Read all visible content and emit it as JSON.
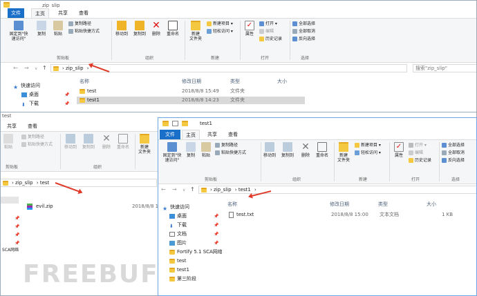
{
  "ribbon": {
    "tabs": [
      "文件",
      "主页",
      "共享",
      "查看"
    ],
    "pin_quick": "固定到\"快\n速访问\"",
    "copy": "复制",
    "paste": "粘贴",
    "copy_path": "复制路径",
    "paste_shortcut": "粘贴快捷方式",
    "cut": "",
    "move_to": "移动到",
    "copy_to": "复制到",
    "delete": "删除",
    "rename": "重命名",
    "new_folder": "新建\n文件夹",
    "new_item": "新建项目",
    "easy_access": "轻松访问",
    "properties": "属性",
    "open": "打开",
    "edit": "编辑",
    "history": "历史记录",
    "select_all": "全部选择",
    "select_none": "全部取消",
    "invert": "反向选择",
    "groups": {
      "clipboard": "剪贴板",
      "organize": "组织",
      "new": "新建",
      "open": "打开",
      "select": "选择"
    }
  },
  "win1": {
    "title": "zip_slip",
    "path": [
      "zip_slip"
    ],
    "search_placeholder": "搜索\"zip_slip\"",
    "columns": {
      "name": "名称",
      "date": "修改日期",
      "type": "类型",
      "size": "大小"
    },
    "quick_access": "快速访问",
    "nav": [
      {
        "label": "桌面"
      },
      {
        "label": "下载"
      }
    ],
    "rows": [
      {
        "name": "test",
        "date": "2018/8/8 15:49",
        "type": "文件夹",
        "size": ""
      },
      {
        "name": "test1",
        "date": "2018/8/8 14:23",
        "type": "文件夹",
        "size": ""
      }
    ]
  },
  "win2": {
    "title": "test",
    "path": [
      "zip_slip",
      "test"
    ],
    "sca_label": "SCA网络",
    "rows": [
      {
        "name": "evil.zip",
        "date": "2018/8/8 1..."
      }
    ]
  },
  "win3": {
    "title": "test1",
    "path": [
      "zip_slip",
      "test1"
    ],
    "columns": {
      "name": "名称",
      "date": "修改日期",
      "type": "类型",
      "size": "大小"
    },
    "quick_access": "快速访问",
    "nav": [
      {
        "label": "桌面",
        "icon": "desktop-icon",
        "pinned": true
      },
      {
        "label": "下载",
        "icon": "download-icon",
        "pinned": true
      },
      {
        "label": "文档",
        "icon": "documents-icon",
        "pinned": true
      },
      {
        "label": "图片",
        "icon": "pictures-icon",
        "pinned": true
      },
      {
        "label": "Fortify 5.1 SCA网络",
        "icon": "folder-icon",
        "pinned": false
      },
      {
        "label": "test",
        "icon": "folder-icon",
        "pinned": false
      },
      {
        "label": "test1",
        "icon": "folder-icon",
        "pinned": false
      },
      {
        "label": "第三阶段",
        "icon": "folder-icon",
        "pinned": false
      }
    ],
    "rows": [
      {
        "name": "test.txt",
        "date": "2018/8/8 15:00",
        "type": "文本文档",
        "size": "1 KB"
      }
    ]
  },
  "watermark": "FREEBUF",
  "colors": {
    "accent": "#1a6fc9",
    "arrow": "#e03b2a",
    "folder": "#f5c842",
    "selected": "#cce8ff"
  }
}
